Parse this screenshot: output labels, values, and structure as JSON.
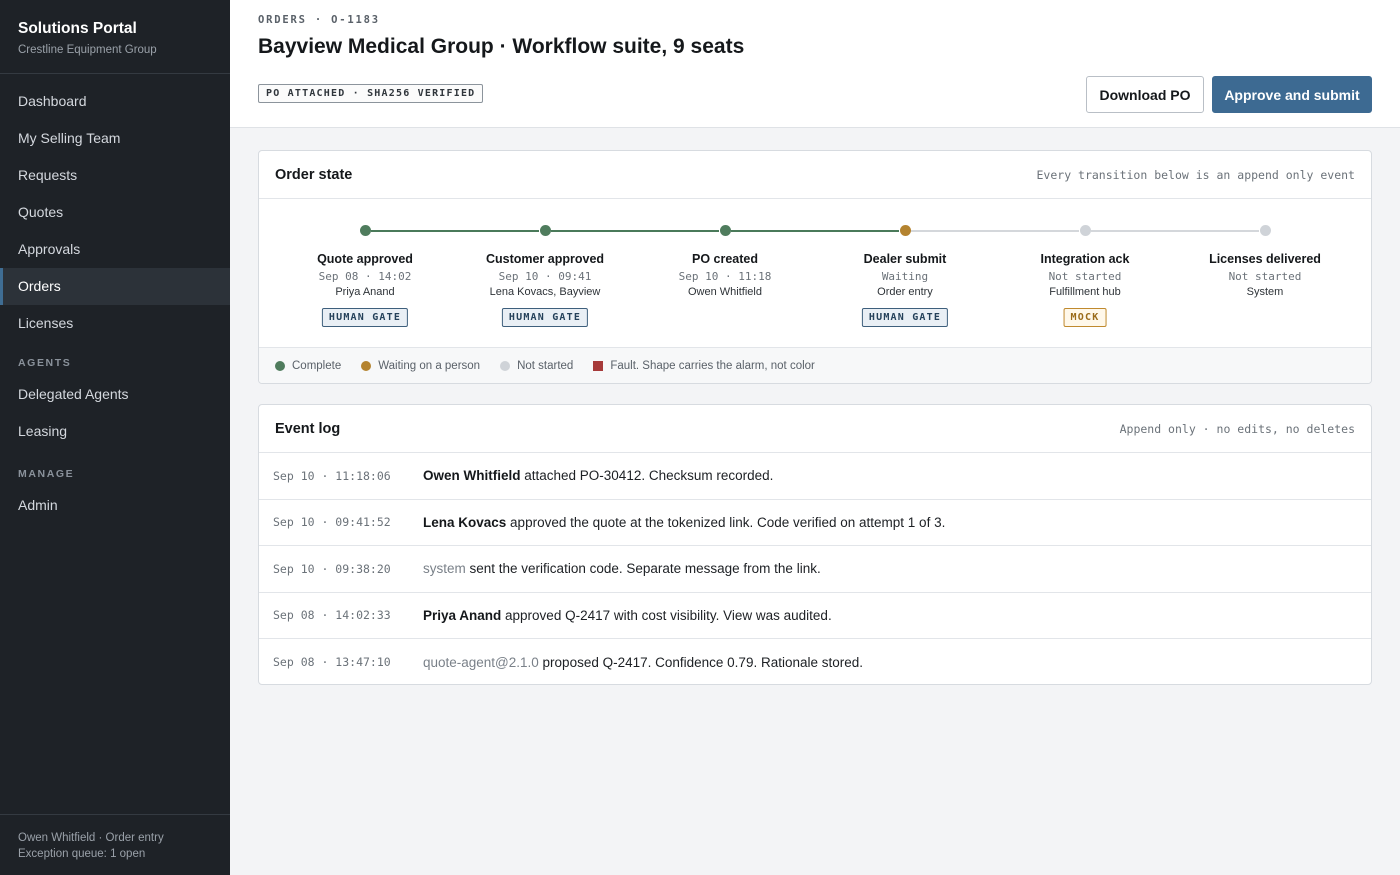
{
  "sidebar": {
    "title": "Solutions Portal",
    "subtitle": "Crestline Equipment Group",
    "items": [
      {
        "label": "Dashboard"
      },
      {
        "label": "My Selling Team"
      },
      {
        "label": "Requests"
      },
      {
        "label": "Quotes"
      },
      {
        "label": "Approvals"
      },
      {
        "label": "Orders",
        "active": true
      },
      {
        "label": "Licenses"
      }
    ],
    "agents_section": "AGENTS",
    "agents_items": [
      {
        "label": "Delegated Agents"
      },
      {
        "label": "Leasing"
      }
    ],
    "manage_section": "MANAGE",
    "manage_items": [
      {
        "label": "Admin"
      }
    ],
    "footer_user": "Owen Whitfield · Order entry",
    "footer_queue": "Exception queue: 1 open"
  },
  "header": {
    "breadcrumb": "ORDERS · O-1183",
    "title": "Bayview Medical Group · Workflow suite, 9 seats",
    "po_badge": "PO ATTACHED · SHA256 VERIFIED",
    "download_label": "Download PO",
    "approve_label": "Approve and submit"
  },
  "order_state": {
    "title": "Order state",
    "note": "Every transition below is an append only event",
    "steps": [
      {
        "name": "Quote approved",
        "time": "Sep 08 · 14:02",
        "actor": "Priya Anand",
        "status": "complete",
        "gate": "HUMAN GATE"
      },
      {
        "name": "Customer approved",
        "time": "Sep 10 · 09:41",
        "actor": "Lena Kovacs, Bayview",
        "status": "complete",
        "gate": "HUMAN GATE"
      },
      {
        "name": "PO created",
        "time": "Sep 10 · 11:18",
        "actor": "Owen Whitfield",
        "status": "complete",
        "gate": ""
      },
      {
        "name": "Dealer submit",
        "time": "Waiting",
        "actor": "Order entry",
        "status": "waiting",
        "gate": "HUMAN GATE"
      },
      {
        "name": "Integration ack",
        "time": "Not started",
        "actor": "Fulfillment hub",
        "status": "notstarted",
        "gate": "MOCK"
      },
      {
        "name": "Licenses delivered",
        "time": "Not started",
        "actor": "System",
        "status": "notstarted",
        "gate": ""
      }
    ],
    "legend": {
      "complete": "Complete",
      "waiting": "Waiting on a person",
      "notstarted": "Not started",
      "fault": "Fault. Shape carries the alarm, not color"
    },
    "colors": {
      "complete": "#4f7c5d",
      "waiting": "#b4832f",
      "notstarted": "#cfd3d8",
      "fault": "#a63a3a",
      "accent": "#3d6a92"
    }
  },
  "event_log": {
    "title": "Event log",
    "note": "Append only · no edits, no deletes",
    "rows": [
      {
        "time": "Sep 10 · 11:18:06",
        "actor": "Owen Whitfield",
        "actor_type": "person",
        "text": " attached PO-30412. Checksum recorded."
      },
      {
        "time": "Sep 10 · 09:41:52",
        "actor": "Lena Kovacs",
        "actor_type": "person",
        "text": " approved the quote at the tokenized link. Code verified on attempt 1 of 3."
      },
      {
        "time": "Sep 10 · 09:38:20",
        "actor": "system",
        "actor_type": "system",
        "text": " sent the verification code. Separate message from the link."
      },
      {
        "time": "Sep 08 · 14:02:33",
        "actor": "Priya Anand",
        "actor_type": "person",
        "text": " approved Q-2417 with cost visibility. View was audited."
      },
      {
        "time": "Sep 08 · 13:47:10",
        "actor": "quote-agent@2.1.0",
        "actor_type": "system",
        "text": " proposed Q-2417. Confidence 0.79. Rationale stored."
      }
    ]
  }
}
